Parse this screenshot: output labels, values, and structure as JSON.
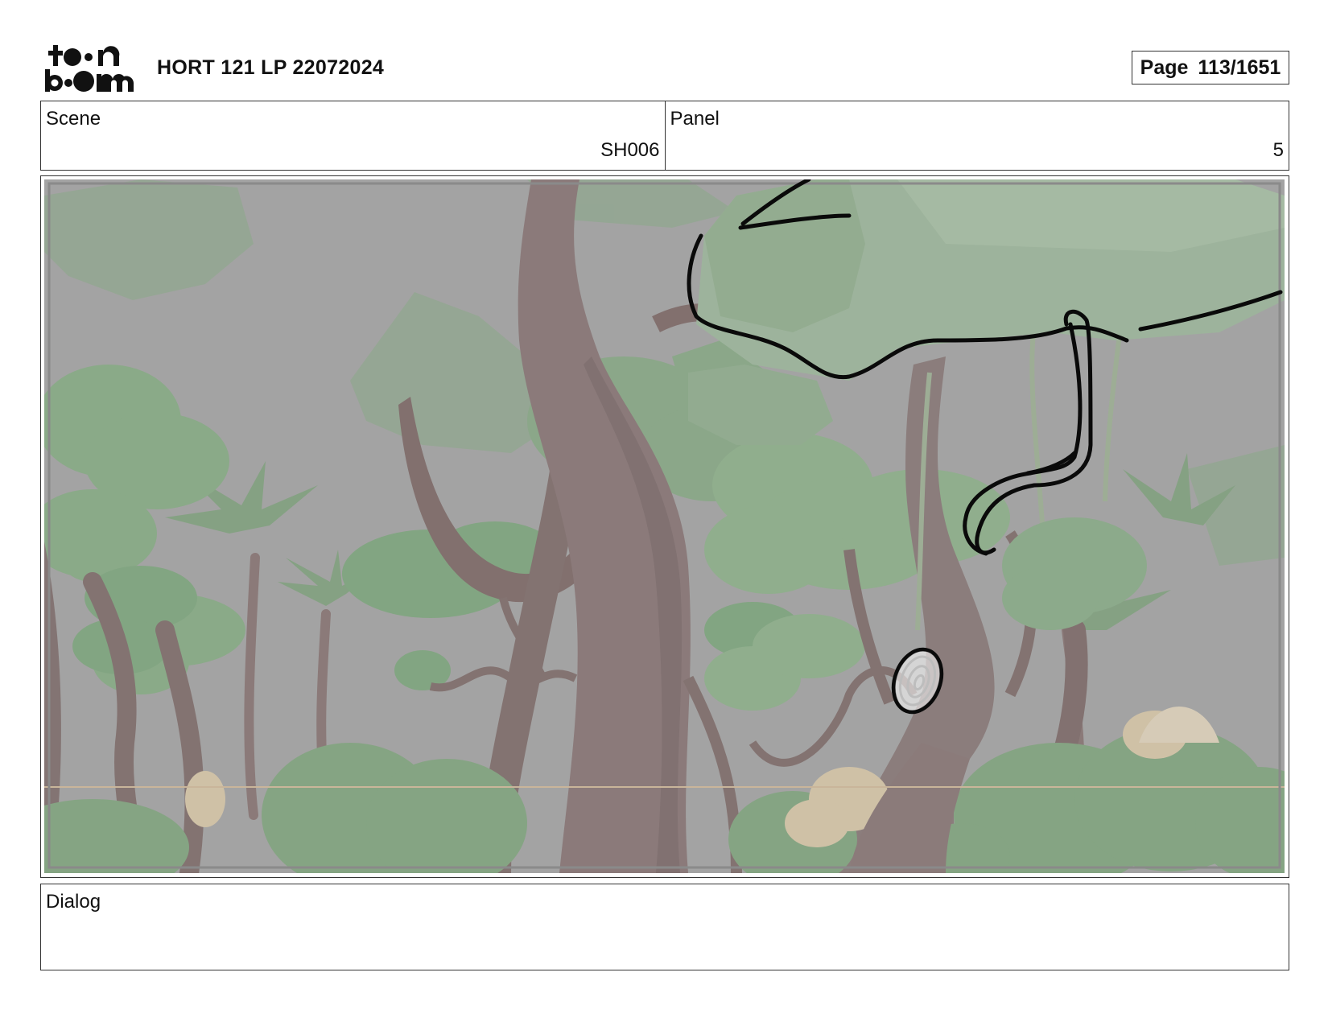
{
  "header": {
    "logo_text": "toon boom",
    "title": "HORT 121 LP 22072024",
    "page_label": "Page",
    "page_number": "113/1651"
  },
  "scene": {
    "label": "Scene",
    "value": "SH006"
  },
  "panel": {
    "label": "Panel",
    "value": "5"
  },
  "dialog": {
    "label": "Dialog",
    "text": ""
  },
  "colors": {
    "border": "#333333",
    "sky": "#a2a2a2",
    "foliage": "#86a884",
    "trunk": "#7d6d6b",
    "sketch_line": "#0a0a0a"
  }
}
